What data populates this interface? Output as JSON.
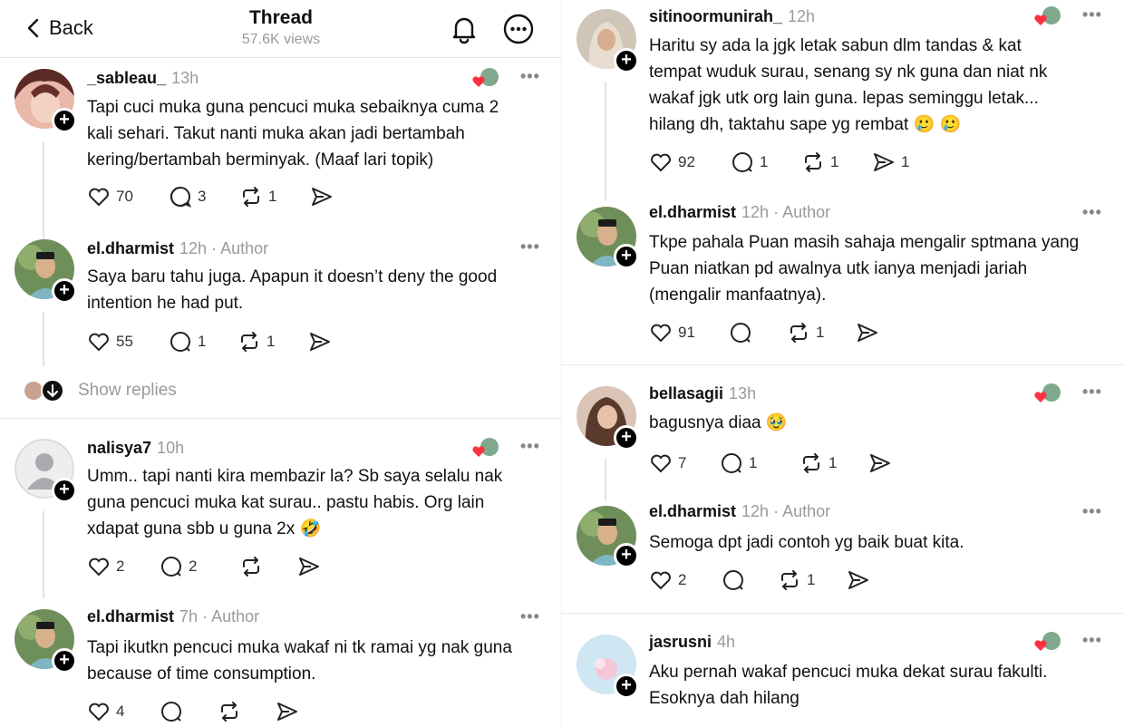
{
  "header": {
    "back_label": "Back",
    "title": "Thread",
    "views": "57.6K views"
  },
  "left": {
    "posts": [
      {
        "username": "_sableau_",
        "time": "13h",
        "author_tag": "",
        "text_lines": [
          "Tapi cuci muka guna pencuci muka sebaiknya cuma 2",
          "kali sehari. Takut nanti muka akan jadi bertambah",
          "kering/bertambah berminyak. (Maaf lari topik)"
        ],
        "likes": "70",
        "replies": "3",
        "reposts": "1",
        "shares": ""
      },
      {
        "username": "el.dharmist",
        "time": "12h",
        "author_tag": "· Author",
        "text_lines": [
          "Saya baru tahu juga. Apapun it doesn’t deny the good",
          "intention he had put."
        ],
        "likes": "55",
        "replies": "1",
        "reposts": "1",
        "shares": ""
      },
      {
        "username": "nalisya7",
        "time": "10h",
        "author_tag": "",
        "text_lines": [
          "Umm.. tapi nanti kira membazir la? Sb saya selalu nak",
          "guna pencuci muka kat surau.. pastu habis. Org lain",
          "xdapat guna sbb u guna 2x 🤣"
        ],
        "likes": "2",
        "replies": "2",
        "reposts": "",
        "shares": ""
      },
      {
        "username": "el.dharmist",
        "time": "7h",
        "author_tag": "· Author",
        "text_lines": [
          "Tapi ikutkn pencuci muka wakaf ni tk ramai yg nak guna",
          "because of time consumption."
        ],
        "likes": "4",
        "replies": "",
        "reposts": "",
        "shares": ""
      }
    ],
    "show_replies": "Show replies"
  },
  "right": {
    "posts": [
      {
        "username": "sitinoormunirah_",
        "time": "12h",
        "author_tag": "",
        "text_lines": [
          "Haritu sy ada la jgk letak sabun dlm tandas & kat",
          "tempat wuduk surau, senang sy nk guna dan niat nk",
          "wakaf jgk utk org lain guna. lepas seminggu letak...",
          "hilang dh, taktahu sape yg rembat 🥲 🥲"
        ],
        "likes": "92",
        "replies": "1",
        "reposts": "1",
        "shares": "1"
      },
      {
        "username": "el.dharmist",
        "time": "12h",
        "author_tag": "· Author",
        "text_lines": [
          "Tkpe pahala Puan masih sahaja mengalir sptmana yang",
          "Puan niatkan pd awalnya utk ianya menjadi jariah",
          "(mengalir manfaatnya)."
        ],
        "likes": "91",
        "replies": "",
        "reposts": "1",
        "shares": ""
      },
      {
        "username": "bellasagii",
        "time": "13h",
        "author_tag": "",
        "text_lines": [
          "bagusnya diaa 🥹"
        ],
        "likes": "7",
        "replies": "1",
        "reposts": "1",
        "shares": ""
      },
      {
        "username": "el.dharmist",
        "time": "12h",
        "author_tag": "· Author",
        "text_lines": [
          "Semoga dpt jadi contoh yg baik buat kita."
        ],
        "likes": "2",
        "replies": "",
        "reposts": "1",
        "shares": ""
      },
      {
        "username": "jasrusni",
        "time": "4h",
        "author_tag": "",
        "text_lines": [
          "Aku pernah wakaf pencuci muka dekat surau fakulti.",
          "Esoknya dah hilang"
        ],
        "likes": "",
        "replies": "",
        "reposts": "",
        "shares": ""
      }
    ]
  },
  "colors": {
    "heart": "#ff3040",
    "muted": "#9a9a9a",
    "text": "#101010"
  },
  "icons": [
    "chevron-left-icon",
    "bell-icon",
    "more-circle-icon",
    "heart-icon",
    "comment-icon",
    "repost-icon",
    "share-icon",
    "plus-icon",
    "more-dots-icon"
  ]
}
